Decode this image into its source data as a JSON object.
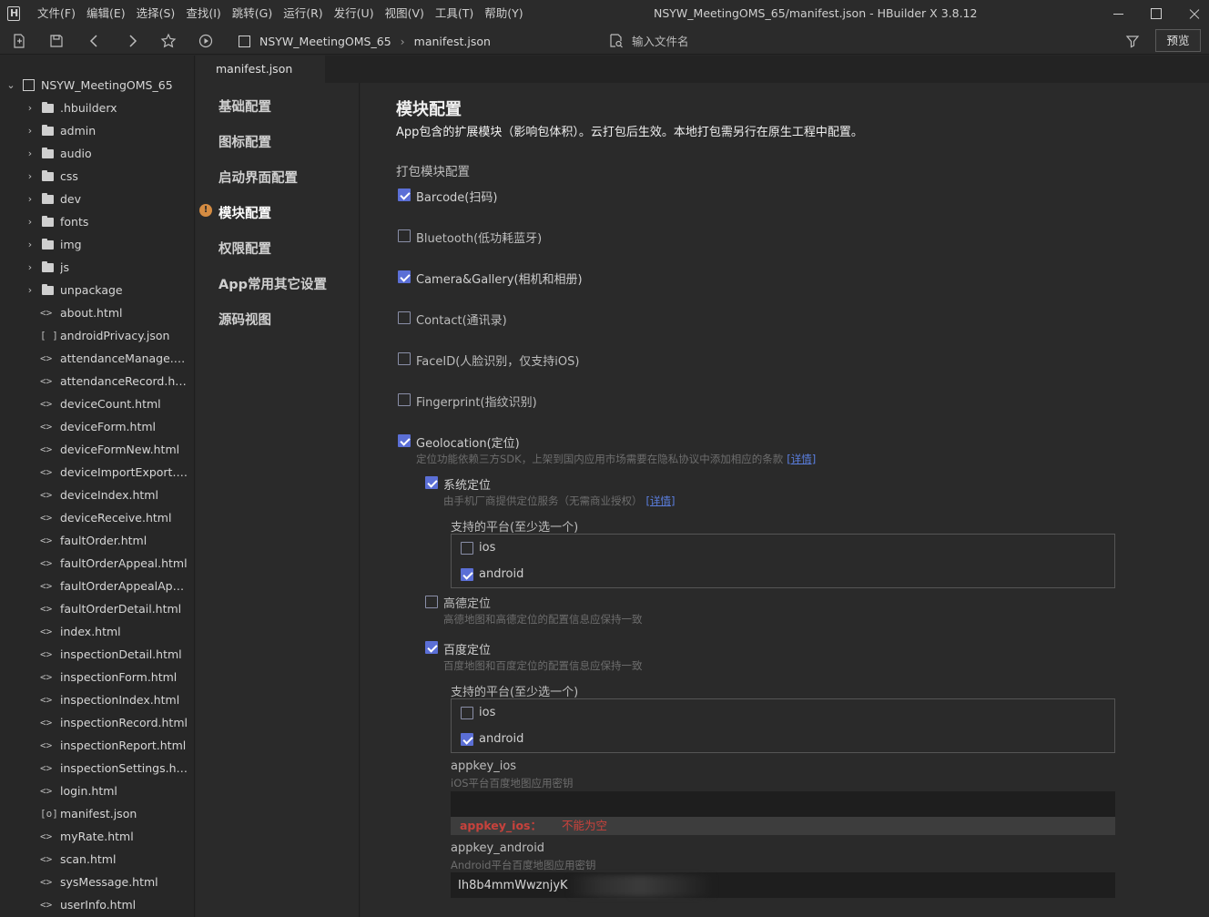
{
  "menu": [
    "文件(F)",
    "编辑(E)",
    "选择(S)",
    "查找(I)",
    "跳转(G)",
    "运行(R)",
    "发行(U)",
    "视图(V)",
    "工具(T)",
    "帮助(Y)"
  ],
  "window_title": "NSYW_MeetingOMS_65/manifest.json - HBuilder X 3.8.12",
  "toolbar": {
    "breadcrumb_project": "NSYW_MeetingOMS_65",
    "breadcrumb_file": "manifest.json",
    "search_placeholder": "输入文件名",
    "preview_label": "预览"
  },
  "sidebar": {
    "project": "NSYW_MeetingOMS_65",
    "folders": [
      ".hbuilderx",
      "admin",
      "audio",
      "css",
      "dev",
      "fonts",
      "img",
      "js",
      "unpackage"
    ],
    "files": [
      {
        "glyph": "<>",
        "name": "about.html"
      },
      {
        "glyph": "[ ]",
        "name": "androidPrivacy.json"
      },
      {
        "glyph": "<>",
        "name": "attendanceManage.html"
      },
      {
        "glyph": "<>",
        "name": "attendanceRecord.html"
      },
      {
        "glyph": "<>",
        "name": "deviceCount.html"
      },
      {
        "glyph": "<>",
        "name": "deviceForm.html"
      },
      {
        "glyph": "<>",
        "name": "deviceFormNew.html"
      },
      {
        "glyph": "<>",
        "name": "deviceImportExport.ht..."
      },
      {
        "glyph": "<>",
        "name": "deviceIndex.html"
      },
      {
        "glyph": "<>",
        "name": "deviceReceive.html"
      },
      {
        "glyph": "<>",
        "name": "faultOrder.html"
      },
      {
        "glyph": "<>",
        "name": "faultOrderAppeal.html"
      },
      {
        "glyph": "<>",
        "name": "faultOrderAppealAppl..."
      },
      {
        "glyph": "<>",
        "name": "faultOrderDetail.html"
      },
      {
        "glyph": "<>",
        "name": "index.html"
      },
      {
        "glyph": "<>",
        "name": "inspectionDetail.html"
      },
      {
        "glyph": "<>",
        "name": "inspectionForm.html"
      },
      {
        "glyph": "<>",
        "name": "inspectionIndex.html"
      },
      {
        "glyph": "<>",
        "name": "inspectionRecord.html"
      },
      {
        "glyph": "<>",
        "name": "inspectionReport.html"
      },
      {
        "glyph": "<>",
        "name": "inspectionSettings.html"
      },
      {
        "glyph": "<>",
        "name": "login.html"
      },
      {
        "glyph": "[o]",
        "name": "manifest.json"
      },
      {
        "glyph": "<>",
        "name": "myRate.html"
      },
      {
        "glyph": "<>",
        "name": "scan.html"
      },
      {
        "glyph": "<>",
        "name": "sysMessage.html"
      },
      {
        "glyph": "<>",
        "name": "userInfo.html"
      }
    ]
  },
  "editor_tab": "manifest.json",
  "settings_nav": [
    "基础配置",
    "图标配置",
    "启动界面配置",
    "模块配置",
    "权限配置",
    "App常用其它设置",
    "源码视图"
  ],
  "settings_nav_warning": "!",
  "content": {
    "title": "模块配置",
    "description": "App包含的扩展模块（影响包体积）。云打包后生效。本地打包需另行在原生工程中配置。",
    "section": "打包模块配置",
    "modules": [
      {
        "label": "Barcode(扫码)",
        "checked": true
      },
      {
        "label": "Bluetooth(低功耗蓝牙)",
        "checked": false
      },
      {
        "label": "Camera&Gallery(相机和相册)",
        "checked": true
      },
      {
        "label": "Contact(通讯录)",
        "checked": false
      },
      {
        "label": "FaceID(人脸识别，仅支持iOS)",
        "checked": false
      },
      {
        "label": "Fingerprint(指纹识别)",
        "checked": false
      },
      {
        "label": "Geolocation(定位)",
        "checked": true
      }
    ],
    "geo_hint": "定位功能依赖三方SDK，上架到国内应用市场需要在隐私协议中添加相应的条款",
    "details_link": "[详情]",
    "system_loc": {
      "label": "系统定位",
      "checked": true,
      "hint": "由手机厂商提供定位服务（无需商业授权）"
    },
    "platform_heading": "支持的平台(至少选一个)",
    "system_platforms": [
      {
        "label": "ios",
        "checked": false
      },
      {
        "label": "android",
        "checked": true
      }
    ],
    "amap": {
      "label": "高德定位",
      "checked": false,
      "hint": "高德地图和高德定位的配置信息应保持一致"
    },
    "baidu": {
      "label": "百度定位",
      "checked": true,
      "hint": "百度地图和百度定位的配置信息应保持一致"
    },
    "baidu_platforms": [
      {
        "label": "ios",
        "checked": false
      },
      {
        "label": "android",
        "checked": true
      }
    ],
    "appkey_ios": {
      "label": "appkey_ios",
      "hint": "iOS平台百度地图应用密钥",
      "value": ""
    },
    "error": {
      "field": "appkey_ios：",
      "message": "不能为空"
    },
    "appkey_android": {
      "label": "appkey_android",
      "hint": "Android平台百度地图应用密钥",
      "value": "Ih8b4mmWwznjyK"
    }
  },
  "colors": {
    "accent": "#5b6fd6",
    "error": "#c8423c",
    "link": "#5b7fe0"
  }
}
